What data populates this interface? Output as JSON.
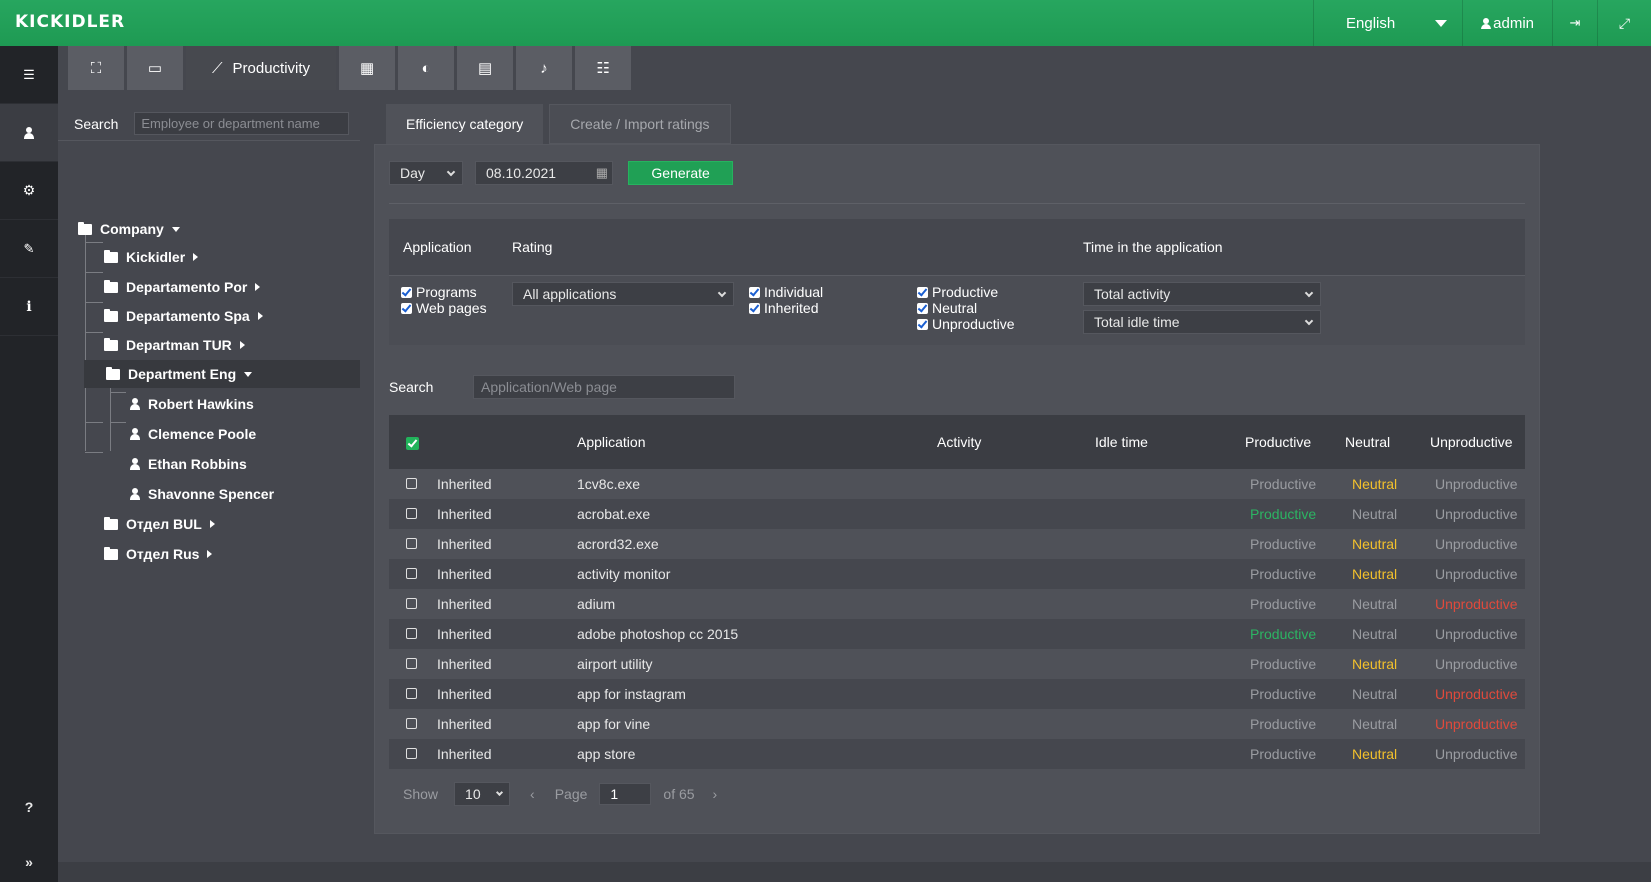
{
  "brand": {
    "logo": "KICKIDLER"
  },
  "header": {
    "language": "English",
    "user": "admin"
  },
  "sidebar": {
    "items": [
      {
        "name": "list-icon",
        "glyph": "☰"
      },
      {
        "name": "user-icon",
        "glyph": "👤"
      },
      {
        "name": "settings-icon",
        "glyph": "⚙"
      },
      {
        "name": "wrench-icon",
        "glyph": "🔧"
      },
      {
        "name": "info-icon",
        "glyph": "i"
      }
    ],
    "help": "?",
    "expand": "»"
  },
  "tabs": {
    "productivity_label": "Productivity"
  },
  "tree": {
    "search_label": "Search",
    "search_placeholder": "Employee or department name",
    "company": "Company",
    "departments": [
      "Kickidler",
      "Departamento Por",
      "Departamento Spa",
      "Departman TUR",
      "Department Eng",
      "Отдел BUL",
      "Отдел Rus"
    ],
    "employees": [
      "Robert Hawkins",
      "Clemence Poole",
      "Ethan Robbins",
      "Shavonne Spencer"
    ]
  },
  "content_tabs": {
    "efficiency": "Efficiency category",
    "create": "Create / Import ratings"
  },
  "filters": {
    "period": "Day",
    "date": "08.10.2021",
    "generate": "Generate",
    "headers": {
      "application": "Application",
      "rating": "Rating",
      "time": "Time in the application"
    },
    "programs": "Programs",
    "web_pages": "Web pages",
    "rating_select": "All applications",
    "individual": "Individual",
    "inherited": "Inherited",
    "productive": "Productive",
    "neutral": "Neutral",
    "unproductive": "Unproductive",
    "time_select_1": "Total activity",
    "time_select_2": "Total idle time"
  },
  "app_search": {
    "label": "Search",
    "placeholder": "Application/Web page"
  },
  "table": {
    "columns": {
      "application": "Application",
      "activity": "Activity",
      "idle": "Idle time",
      "productive": "Productive",
      "neutral": "Neutral",
      "unproductive": "Unproductive"
    },
    "rows": [
      {
        "type": "Inherited",
        "app": "1cv8c.exe",
        "productive": "Productive",
        "neutral": "Neutral",
        "unproductive": "Unproductive",
        "rating": "neutral"
      },
      {
        "type": "Inherited",
        "app": "acrobat.exe",
        "productive": "Productive",
        "neutral": "Neutral",
        "unproductive": "Unproductive",
        "rating": "productive"
      },
      {
        "type": "Inherited",
        "app": "acrord32.exe",
        "productive": "Productive",
        "neutral": "Neutral",
        "unproductive": "Unproductive",
        "rating": "neutral"
      },
      {
        "type": "Inherited",
        "app": "activity monitor",
        "productive": "Productive",
        "neutral": "Neutral",
        "unproductive": "Unproductive",
        "rating": "neutral"
      },
      {
        "type": "Inherited",
        "app": "adium",
        "productive": "Productive",
        "neutral": "Neutral",
        "unproductive": "Unproductive",
        "rating": "unproductive"
      },
      {
        "type": "Inherited",
        "app": "adobe photoshop cc 2015",
        "productive": "Productive",
        "neutral": "Neutral",
        "unproductive": "Unproductive",
        "rating": "productive"
      },
      {
        "type": "Inherited",
        "app": "airport utility",
        "productive": "Productive",
        "neutral": "Neutral",
        "unproductive": "Unproductive",
        "rating": "neutral"
      },
      {
        "type": "Inherited",
        "app": "app for instagram",
        "productive": "Productive",
        "neutral": "Neutral",
        "unproductive": "Unproductive",
        "rating": "unproductive"
      },
      {
        "type": "Inherited",
        "app": "app for vine",
        "productive": "Productive",
        "neutral": "Neutral",
        "unproductive": "Unproductive",
        "rating": "unproductive"
      },
      {
        "type": "Inherited",
        "app": "app store",
        "productive": "Productive",
        "neutral": "Neutral",
        "unproductive": "Unproductive",
        "rating": "neutral"
      }
    ]
  },
  "pager": {
    "show": "Show",
    "per_page": "10",
    "page": "Page",
    "current": "1",
    "of": "of 65",
    "prev": "‹",
    "next": "›"
  },
  "colors": {
    "accent": "#20a055",
    "productive": "#2cb463",
    "neutral": "#f3c12c",
    "unproductive": "#e04a3c"
  }
}
